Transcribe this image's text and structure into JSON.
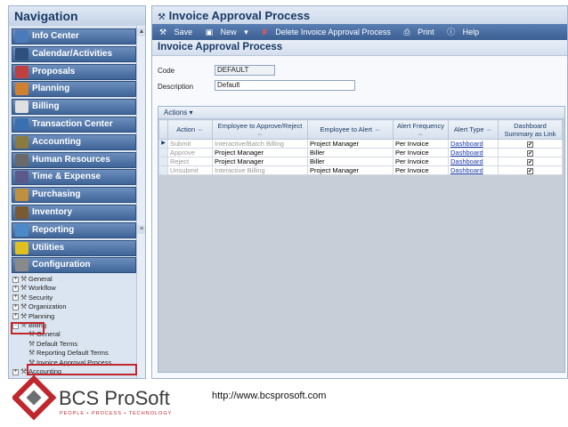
{
  "nav": {
    "title": "Navigation",
    "items": [
      {
        "label": "Info Center",
        "icon": "info-center-icon",
        "color": "#4a7ab8"
      },
      {
        "label": "Calendar/Activities",
        "icon": "calendar-icon",
        "color": "#2f4f7c"
      },
      {
        "label": "Proposals",
        "icon": "proposals-icon",
        "color": "#c04040"
      },
      {
        "label": "Planning",
        "icon": "planning-icon",
        "color": "#d08030"
      },
      {
        "label": "Billing",
        "icon": "billing-icon",
        "color": "#e0e0e0"
      },
      {
        "label": "Transaction Center",
        "icon": "transaction-center-icon",
        "color": "#3a6fb0"
      },
      {
        "label": "Accounting",
        "icon": "accounting-icon",
        "color": "#8a7a40"
      },
      {
        "label": "Human Resources",
        "icon": "human-resources-icon",
        "color": "#6a6a6a"
      },
      {
        "label": "Time & Expense",
        "icon": "time-expense-icon",
        "color": "#5a5a8a"
      },
      {
        "label": "Purchasing",
        "icon": "purchasing-icon",
        "color": "#c09040"
      },
      {
        "label": "Inventory",
        "icon": "inventory-icon",
        "color": "#7a5a30"
      },
      {
        "label": "Reporting",
        "icon": "reporting-icon",
        "color": "#4a8ac8"
      },
      {
        "label": "Utilities",
        "icon": "utilities-icon",
        "color": "#e0c020"
      },
      {
        "label": "Configuration",
        "icon": "configuration-icon",
        "color": "#8a8a8a"
      }
    ],
    "tree": [
      {
        "label": "General",
        "expander": "+"
      },
      {
        "label": "Workflow",
        "expander": "+"
      },
      {
        "label": "Security",
        "expander": "+"
      },
      {
        "label": "Organization",
        "expander": "+"
      },
      {
        "label": "Planning",
        "expander": "+"
      },
      {
        "label": "Billing",
        "expander": "−"
      },
      {
        "label": "General",
        "expander": ""
      },
      {
        "label": "Default Terms",
        "expander": ""
      },
      {
        "label": "Reporting Default Terms",
        "expander": ""
      },
      {
        "label": "Invoice Approval Process",
        "expander": ""
      },
      {
        "label": "Accounting",
        "expander": "+"
      }
    ]
  },
  "main": {
    "title": "Invoice Approval Process",
    "toolbar": {
      "save": "Save",
      "new": "New",
      "delete": "Delete Invoice Approval Process",
      "print": "Print",
      "help": "Help"
    },
    "form_title": "Invoice Approval Process",
    "code_label": "Code",
    "code_value": "DEFAULT",
    "description_label": "Description",
    "description_value": "Default",
    "actions_label": "Actions",
    "columns": [
      "Action",
      "Employee to Approve/Reject",
      "Employee to Alert",
      "Alert Frequency",
      "Alert Type",
      "Dashboard Summary as Link"
    ],
    "rows": [
      {
        "action": "Submit",
        "approve": "Interactive/Batch Billing",
        "alert": "Project Manager",
        "freq": "Per Invoice",
        "type": "Dashboard",
        "dim": true
      },
      {
        "action": "Approve",
        "approve": "Project Manager",
        "alert": "Biller",
        "freq": "Per Invoice",
        "type": "Dashboard",
        "dim": true
      },
      {
        "action": "Reject",
        "approve": "Project Manager",
        "alert": "Biller",
        "freq": "Per Invoice",
        "type": "Dashboard",
        "dim": true
      },
      {
        "action": "Unsubmit",
        "approve": "Interactive Billing",
        "alert": "Project Manager",
        "freq": "Per Invoice",
        "type": "Dashboard",
        "dim": true
      }
    ]
  },
  "footer": {
    "brand": "BCS ProSoft",
    "tagline": "PEOPLE • PROCESS • TECHNOLOGY",
    "url": "http://www.bcsprosoft.com",
    "colors": {
      "red": "#c0272d",
      "gray": "#6d6e71"
    }
  }
}
